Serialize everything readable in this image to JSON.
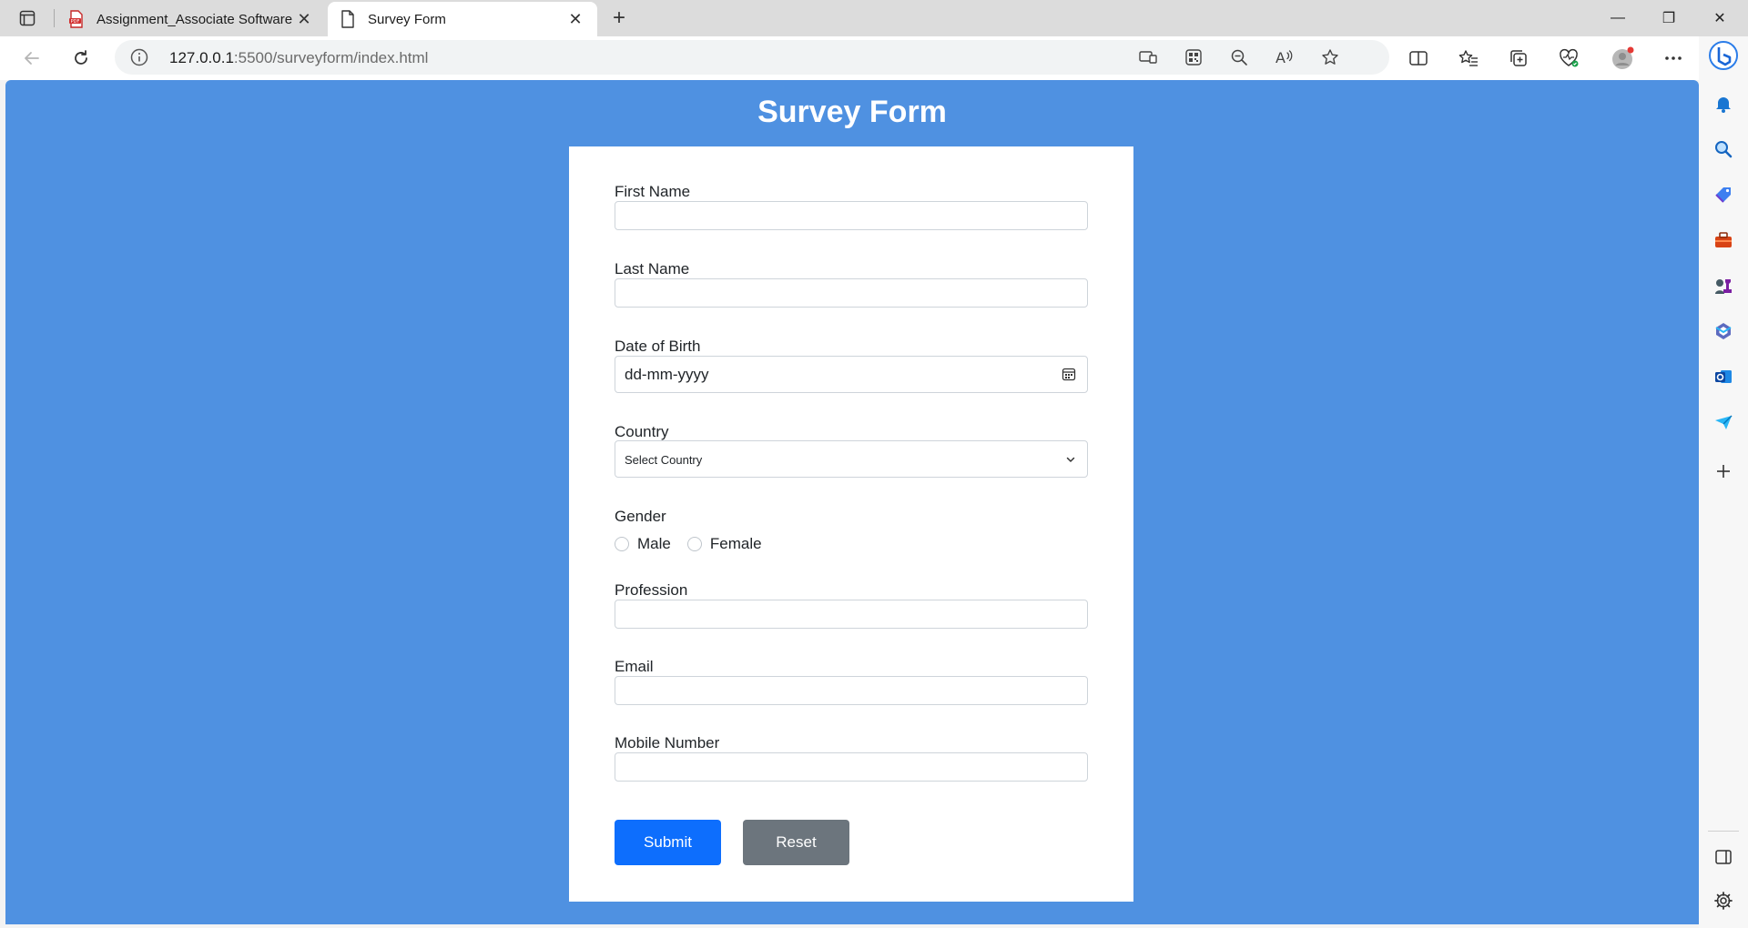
{
  "browser": {
    "tabs": [
      {
        "title": "Assignment_Associate Software E",
        "favicon": "pdf-icon",
        "active": false
      },
      {
        "title": "Survey Form",
        "favicon": "page-icon",
        "active": true
      }
    ],
    "close_glyph": "✕",
    "new_tab_glyph": "+",
    "url_host": "127.0.0.1",
    "url_path": ":5500/surveyform/index.html",
    "window_controls": {
      "minimize": "—",
      "restore": "❐",
      "close": "✕"
    }
  },
  "page": {
    "title": "Survey Form",
    "form": {
      "first_name_label": "First Name",
      "last_name_label": "Last Name",
      "dob_label": "Date of Birth",
      "dob_placeholder": "dd-mm-yyyy",
      "country_label": "Country",
      "country_selected": "Select Country",
      "gender_label": "Gender",
      "gender_options": [
        "Male",
        "Female"
      ],
      "profession_label": "Profession",
      "email_label": "Email",
      "mobile_label": "Mobile Number",
      "submit_label": "Submit",
      "reset_label": "Reset"
    }
  },
  "colors": {
    "page_background": "#4f91e1",
    "submit_button": "#0d6efd",
    "reset_button": "#6c757d"
  }
}
